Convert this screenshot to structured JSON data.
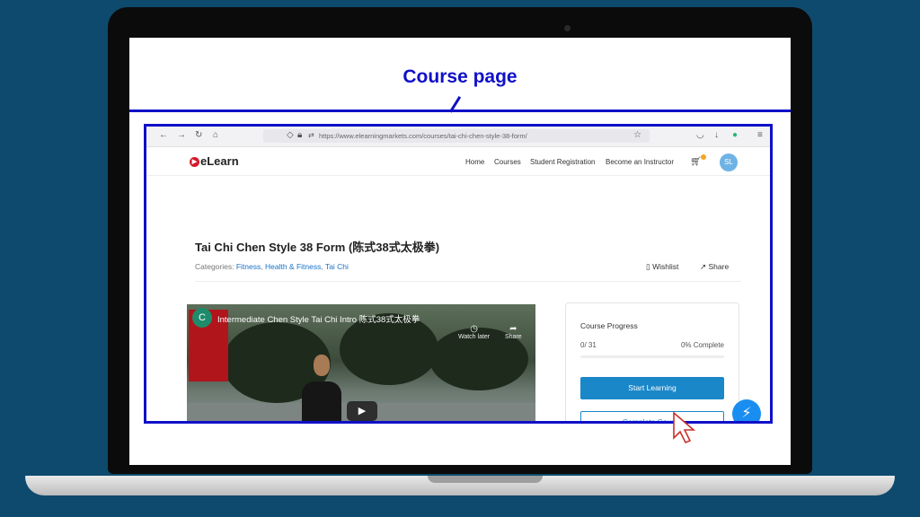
{
  "caption": "Course page",
  "browser": {
    "url": "https://www.elearningmarkets.com/courses/tai-chi-chen-style-38-form/"
  },
  "site": {
    "logo": "eLearn",
    "nav": [
      "Home",
      "Courses",
      "Student Registration",
      "Become an Instructor"
    ],
    "avatar_initials": "SL"
  },
  "course": {
    "title": "Tai Chi Chen Style 38 Form (陈式38式太极拳)",
    "categories_label": "Categories:",
    "categories": [
      "Fitness",
      "Health & Fitness",
      "Tai Chi"
    ],
    "wishlist": "Wishlist",
    "share": "Share"
  },
  "video": {
    "channel_initial": "C",
    "title": "Intermediate Chen Style Tai Chi Intro 陈式38式太极拳",
    "watch_later": "Watch later",
    "share": "Share"
  },
  "progress": {
    "title": "Course Progress",
    "count": "0/ 31",
    "percent_text": "0% Complete",
    "percent_value": 0,
    "start_button": "Start Learning",
    "complete_button": "Complete Course"
  },
  "colors": {
    "accent": "#1a87c9",
    "annotation": "#1010c8",
    "background": "#0e4a6e"
  }
}
